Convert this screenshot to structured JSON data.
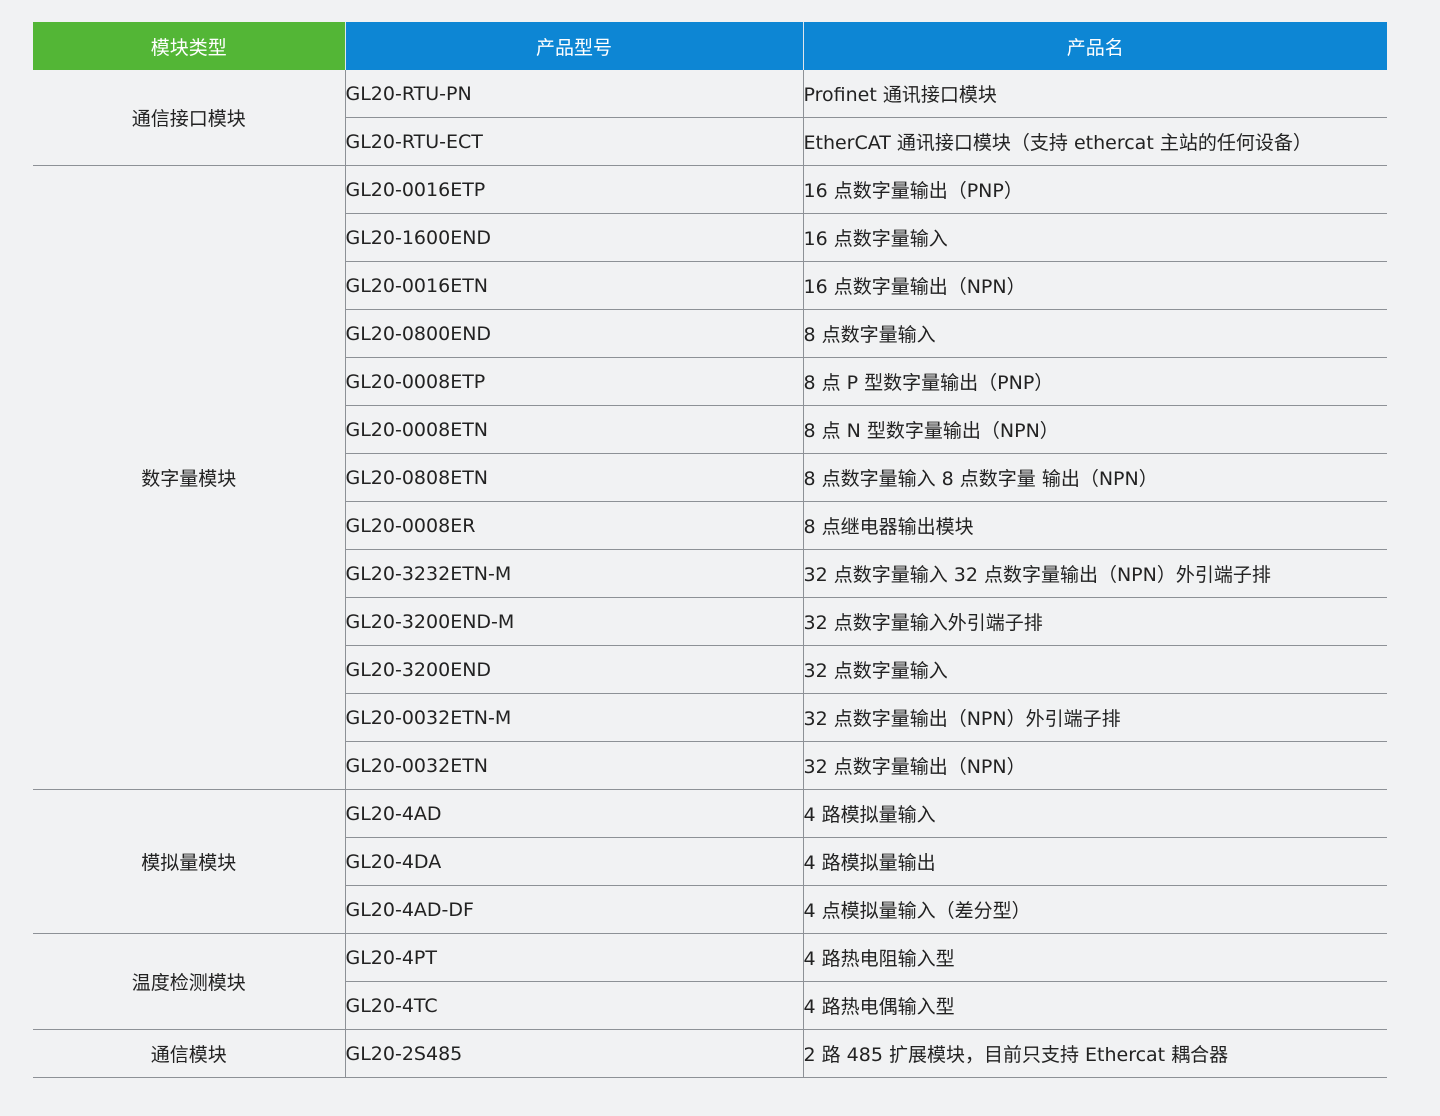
{
  "headers": {
    "type": "模块类型",
    "model": "产品型号",
    "name": "产品名"
  },
  "groups": [
    {
      "type": "通信接口模块",
      "rows": [
        {
          "model": "GL20-RTU-PN",
          "name": "Profinet 通讯接口模块"
        },
        {
          "model": "GL20-RTU-ECT",
          "name": "EtherCAT 通讯接口模块（支持 ethercat 主站的任何设备）"
        }
      ]
    },
    {
      "type": "数字量模块",
      "rows": [
        {
          "model": "GL20-0016ETP",
          "name": "16 点数字量输出（PNP）"
        },
        {
          "model": "GL20-1600END",
          "name": "16 点数字量输入"
        },
        {
          "model": "GL20-0016ETN",
          "name": "16 点数字量输出（NPN）"
        },
        {
          "model": "GL20-0800END",
          "name": "8 点数字量输入"
        },
        {
          "model": "GL20-0008ETP",
          "name": "8 点 P 型数字量输出（PNP）"
        },
        {
          "model": "GL20-0008ETN",
          "name": "8 点 N 型数字量输出（NPN）"
        },
        {
          "model": "GL20-0808ETN",
          "name": "8 点数字量输入 8 点数字量 输出（NPN）"
        },
        {
          "model": "GL20-0008ER",
          "name": "8 点继电器输出模块"
        },
        {
          "model": "GL20-3232ETN-M",
          "name": "32 点数字量输入 32 点数字量输出（NPN）外引端子排"
        },
        {
          "model": "GL20-3200END-M",
          "name": "32 点数字量输入外引端子排"
        },
        {
          "model": "GL20-3200END",
          "name": "32 点数字量输入"
        },
        {
          "model": "GL20-0032ETN-M",
          "name": "32 点数字量输出（NPN）外引端子排"
        },
        {
          "model": "GL20-0032ETN",
          "name": "32 点数字量输出（NPN）"
        }
      ]
    },
    {
      "type": "模拟量模块",
      "rows": [
        {
          "model": "GL20-4AD",
          "name": "4 路模拟量输入"
        },
        {
          "model": "GL20-4DA",
          "name": "4 路模拟量输出"
        },
        {
          "model": "GL20-4AD-DF",
          "name": "4 点模拟量输入（差分型）"
        }
      ]
    },
    {
      "type": "温度检测模块",
      "rows": [
        {
          "model": "GL20-4PT",
          "name": "4 路热电阻输入型"
        },
        {
          "model": "GL20-4TC",
          "name": "4 路热电偶输入型"
        }
      ]
    },
    {
      "type": "通信模块",
      "rows": [
        {
          "model": "GL20-2S485",
          "name": "2 路 485 扩展模块，目前只支持 Ethercat 耦合器"
        }
      ]
    }
  ]
}
